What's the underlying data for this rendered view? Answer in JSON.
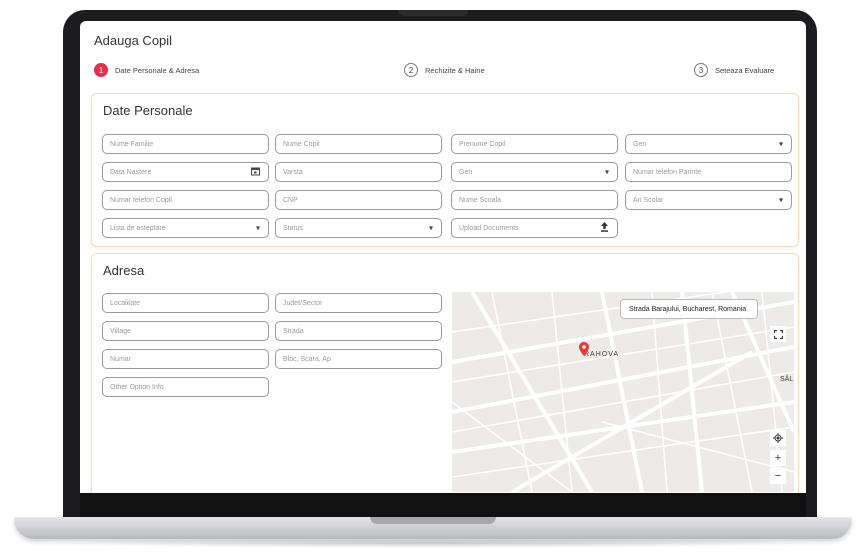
{
  "app": {
    "title": "Adauga Copil"
  },
  "stepper": [
    {
      "number": "1",
      "label": "Date Personale & Adresa",
      "active": true
    },
    {
      "number": "2",
      "label": "Rechizite & Haine",
      "active": false
    },
    {
      "number": "3",
      "label": "Seteaza Evaluare",
      "active": false
    }
  ],
  "personal": {
    "title": "Date Personale",
    "fields": {
      "nume_familie": "Nume Familie",
      "nume_copil": "Nume Copil",
      "prenume_copil": "Prenume Copil",
      "gen_1": "Gen",
      "data_nastere": "Data Nastere",
      "varsta": "Varsta",
      "gen_2": "Gen",
      "telefon_parinte": "Numar telefon Parinte",
      "telefon_copil": "Numar telefon Copil",
      "cnp": "CNP",
      "nume_scoala": "Nume Scoala",
      "an_scolar": "An Scolar",
      "lista_asteptare": "Lista de asteptare",
      "status": "Status",
      "upload": "Upload Documents"
    }
  },
  "address": {
    "title": "Adresa",
    "fields": {
      "localitate": "Localitate",
      "judet": "Judet/Sector",
      "village": "Village",
      "strada": "Strada",
      "numar": "Numar",
      "bloc": "Bloc, Scara, Ap",
      "other": "Other Option Info"
    },
    "map": {
      "location_label": "Strada Barajului, Bucharest, Romania",
      "district_label": "RAHOVA",
      "edge_label": "SĂL"
    }
  },
  "colors": {
    "accent": "#e62e4d",
    "panel_border": "#f0dcc0"
  },
  "icons": {
    "calendar": "calendar-icon",
    "dropdown": "chevron-down-icon",
    "upload": "upload-icon",
    "pin": "map-pin-icon",
    "fullscreen": "fullscreen-icon",
    "locate": "locate-icon",
    "zoom_in": "zoom-in-icon",
    "zoom_out": "zoom-out-icon"
  }
}
